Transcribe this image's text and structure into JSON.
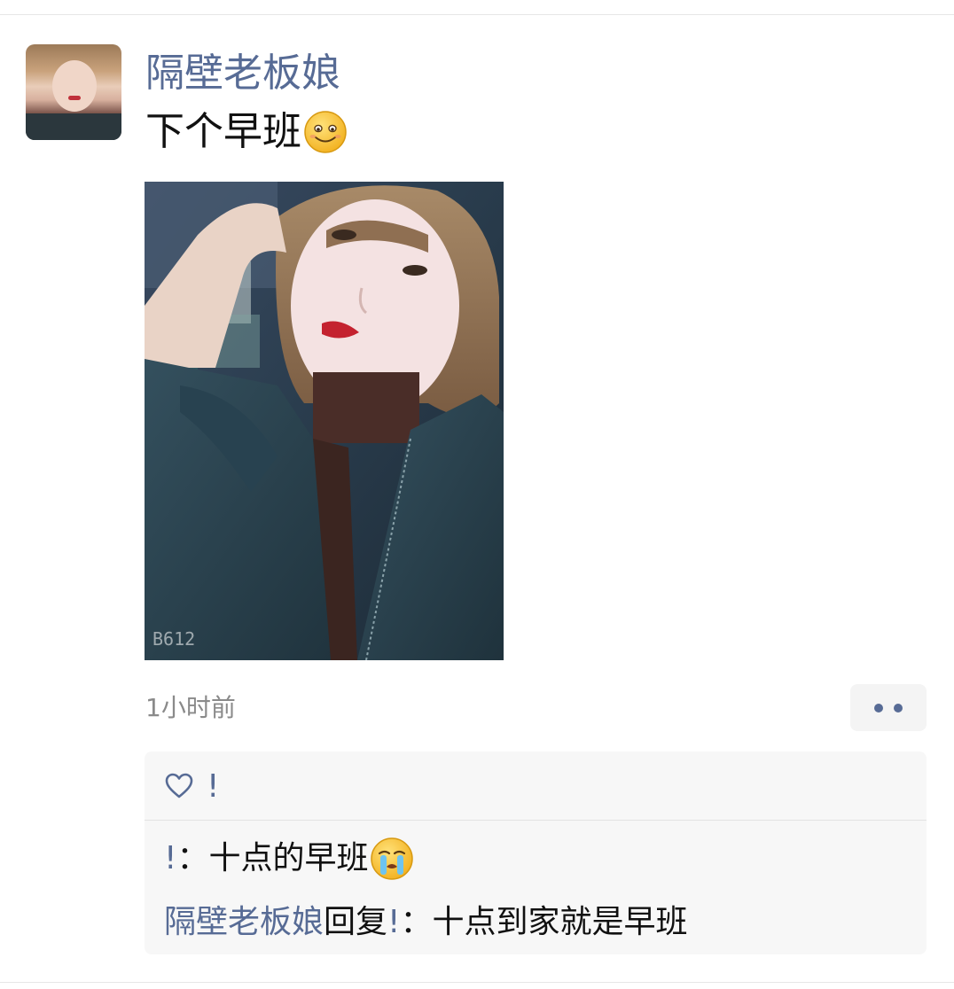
{
  "post": {
    "author": "隔壁老板娘",
    "text": "下个早班",
    "text_emoji": "smile-emoji",
    "photo_watermark": "B612",
    "timestamp": "1小时前"
  },
  "interactions": {
    "likes": [
      "!"
    ],
    "comments": [
      {
        "author": "!",
        "separator": "：",
        "text": "十点的早班",
        "emoji": "crying-emoji"
      },
      {
        "author": "隔壁老板娘",
        "reply_word": "回复",
        "reply_to": "!",
        "separator": "：",
        "text": "十点到家就是早班"
      }
    ]
  },
  "colors": {
    "link": "#576b95",
    "text": "#111111",
    "meta": "#8a8a8a",
    "panel": "#f7f7f7"
  },
  "icons": {
    "like": "heart-icon",
    "more": "more-dots-icon"
  }
}
